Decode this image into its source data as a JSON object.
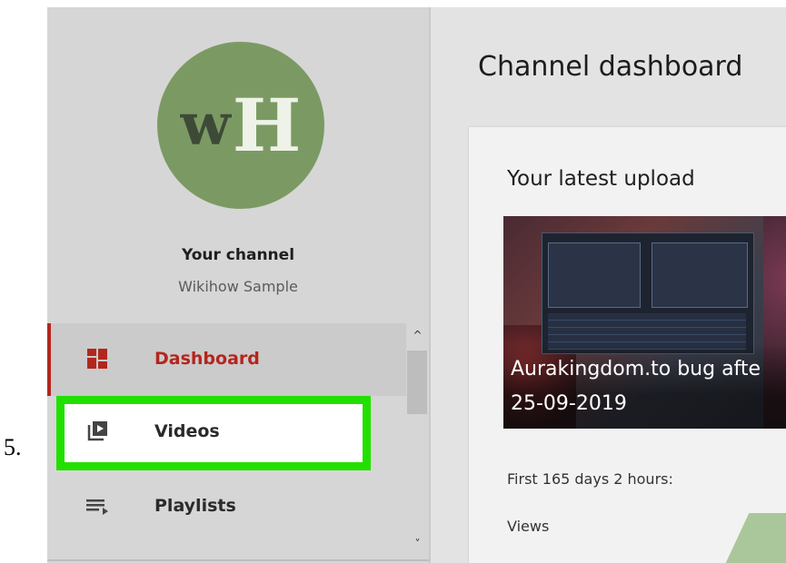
{
  "step_number": "5.",
  "channel": {
    "avatar_letters": [
      "w",
      "H"
    ],
    "name": "Your channel",
    "account": "Wikihow Sample"
  },
  "nav": {
    "items": [
      {
        "label": "Dashboard",
        "icon": "dashboard-icon",
        "active": true
      },
      {
        "label": "Videos",
        "icon": "video-library-icon",
        "highlighted": true
      },
      {
        "label": "Playlists",
        "icon": "playlist-icon"
      }
    ]
  },
  "scroll": {
    "up": "^",
    "down": "˅"
  },
  "main": {
    "title": "Channel dashboard",
    "card": {
      "title": "Your latest upload",
      "video_title_line1": "Aurakingdom.to bug afte",
      "video_title_line2": "25-09-2019",
      "period": "First 165 days 2 hours:",
      "views_label": "Views"
    }
  },
  "colors": {
    "accent_red": "#b3261e",
    "highlight_green": "#21e000",
    "avatar_green": "#7b9a63"
  }
}
